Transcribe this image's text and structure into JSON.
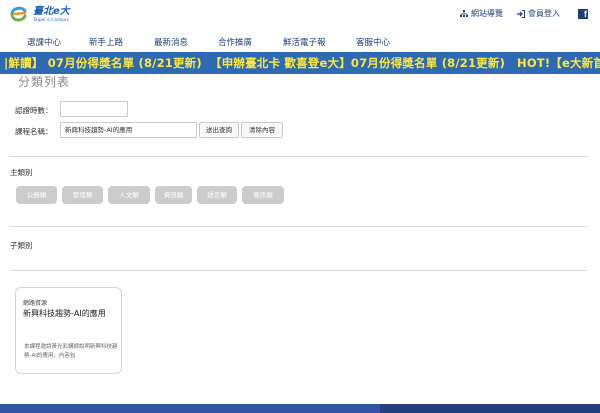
{
  "header": {
    "logo_text": "臺北e大",
    "logo_subtext": "Taipei e-Campus",
    "links": [
      {
        "icon": "sitemap-icon",
        "label": "網站導覽"
      },
      {
        "icon": "login-icon",
        "label": "會員登入"
      }
    ],
    "social_icon": "facebook-icon",
    "social_letter": "f"
  },
  "nav": {
    "items": [
      "選課中心",
      "新手上路",
      "最新消息",
      "合作推廣",
      "鮮活電子報",
      "客服中心"
    ]
  },
  "marquee": {
    "text_1": "|鮮讀】 07月份得獎名單 (8/21更新)",
    "text_2": "【申辦臺北卡 歡喜登e大】07月份得獎名單 (8/21更新)",
    "text_3": "HOT!【e大新首"
  },
  "filters": {
    "page_title": "分類列表",
    "hours_label": "認證時數：",
    "hours_value": "",
    "course_label": "課程名稱：",
    "course_value": "新興科技趨勢-AI的應用",
    "search_button": "送出查詢",
    "clear_button": "清除內容"
  },
  "main_category": {
    "label": "主類別",
    "items": [
      "公務類",
      "管理類",
      "人文類",
      "資訊類",
      "語言類",
      "藝訊類"
    ]
  },
  "sub_category": {
    "label": "子類別"
  },
  "course_card": {
    "category": "網路資源",
    "title": "新興科技趨勢-AI的應用",
    "description": "本課程邀請黃光彩講師說明新興科技趨勢-AI的應用，內容包"
  },
  "colors": {
    "brand_navy": "#1d3f78",
    "marquee_bg": "#2e6ab3",
    "marquee_text": "#ffe838",
    "marquee_hot": "#5ff26c",
    "category_button": "#cccccc",
    "footer": "#2f56a6"
  }
}
